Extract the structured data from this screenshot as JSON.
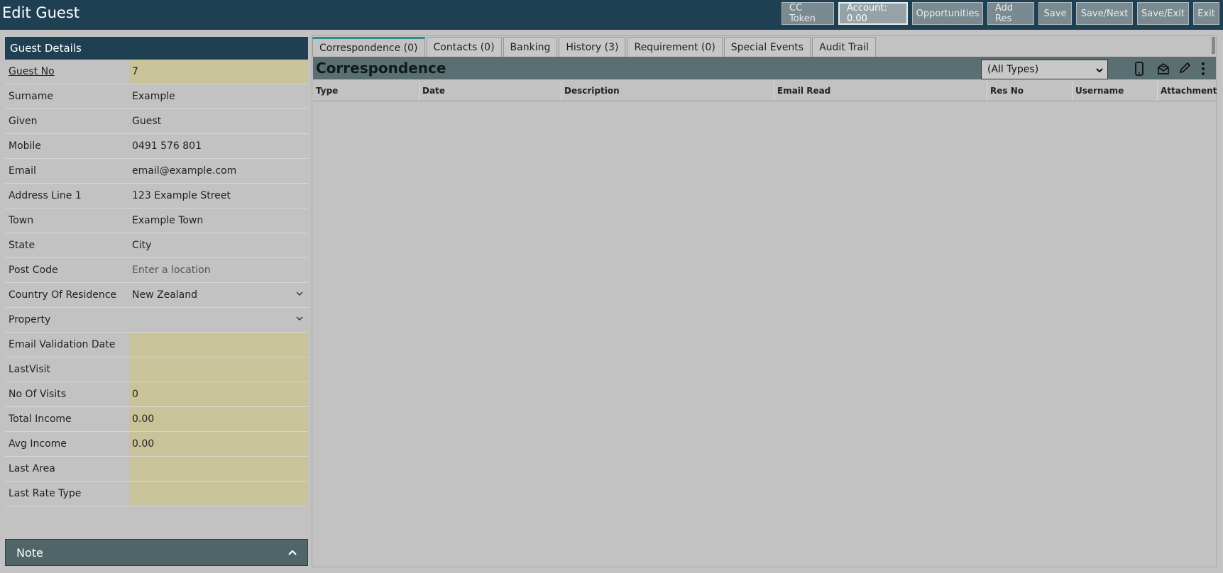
{
  "header": {
    "title": "Edit Guest",
    "buttons": {
      "cc_token": "CC Token",
      "account": "Account: 0.00",
      "opportunities": "Opportunities",
      "add_res": "Add Res",
      "save": "Save",
      "save_next": "Save/Next",
      "save_exit": "Save/Exit",
      "exit": "Exit"
    }
  },
  "guest_details": {
    "heading": "Guest Details",
    "fields": [
      {
        "label": "Guest No",
        "value": "7"
      },
      {
        "label": "Surname",
        "value": "Example"
      },
      {
        "label": "Given",
        "value": "Guest"
      },
      {
        "label": "Mobile",
        "value": "0491 576 801"
      },
      {
        "label": "Email",
        "value": "email@example.com"
      },
      {
        "label": "Address Line 1",
        "value": "123 Example Street"
      },
      {
        "label": "Town",
        "value": "Example Town"
      },
      {
        "label": "State",
        "value": "City"
      },
      {
        "label": "Post Code",
        "value": "",
        "placeholder": "Enter a location"
      },
      {
        "label": "Country Of Residence",
        "value": "New Zealand"
      },
      {
        "label": "Property",
        "value": ""
      },
      {
        "label": "Email Validation Date",
        "value": ""
      },
      {
        "label": "LastVisit",
        "value": ""
      },
      {
        "label": "No Of Visits",
        "value": "0"
      },
      {
        "label": "Total Income",
        "value": "0.00"
      },
      {
        "label": "Avg Income",
        "value": "0.00"
      },
      {
        "label": "Last Area",
        "value": ""
      },
      {
        "label": "Last Rate Type",
        "value": ""
      }
    ]
  },
  "note": {
    "label": "Note"
  },
  "tabs": [
    {
      "label": "Correspondence (0)"
    },
    {
      "label": "Contacts (0)"
    },
    {
      "label": "Banking"
    },
    {
      "label": "History (3)"
    },
    {
      "label": "Requirement (0)"
    },
    {
      "label": "Special Events"
    },
    {
      "label": "Audit Trail"
    }
  ],
  "correspondence": {
    "title": "Correspondence",
    "type_filter": "(All Types)",
    "columns": [
      "Type",
      "Date",
      "Description",
      "Email Read",
      "Res No",
      "Username",
      "Attachment"
    ]
  },
  "icons": [
    "mobile-icon",
    "mail-icon",
    "edit-icon",
    "more-icon",
    "chevron-down-icon",
    "chevron-up-icon"
  ]
}
